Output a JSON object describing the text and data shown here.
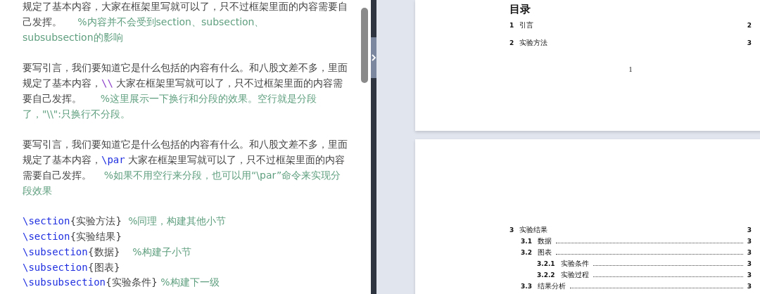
{
  "editor": {
    "paragraphs": [
      {
        "lines": [
          [
            {
              "kind": "text",
              "text": "规定了基本内容，大家在框架里写就可以了，只不过框架里面的内容需要自"
            }
          ],
          [
            {
              "kind": "text",
              "text": "己发挥。     "
            },
            {
              "kind": "comment",
              "text": "%内容并不会受到section、subsection、"
            }
          ],
          [
            {
              "kind": "comment",
              "text": "subsubsection的影响"
            }
          ]
        ]
      },
      {
        "lines": [
          [
            {
              "kind": "text",
              "text": "要写引言，我们要知道它是什么包括的内容有什么。和八股文差不多，里面"
            }
          ],
          [
            {
              "kind": "text",
              "text": "规定了基本内容，"
            },
            {
              "kind": "linebreak",
              "text": "\\\\"
            },
            {
              "kind": "text",
              "text": " 大家在框架里写就可以了，只不过框架里面的内容需"
            }
          ],
          [
            {
              "kind": "text",
              "text": "要自己发挥。      "
            },
            {
              "kind": "comment",
              "text": "%这里展示一下换行和分段的效果。空行就是分段"
            }
          ],
          [
            {
              "kind": "comment",
              "text": "了，\"\\\\\":只换行不分段。"
            }
          ]
        ]
      },
      {
        "lines": [
          [
            {
              "kind": "text",
              "text": "要写引言，我们要知道它是什么包括的内容有什么。和八股文差不多，里面"
            }
          ],
          [
            {
              "kind": "text",
              "text": "规定了基本内容，"
            },
            {
              "kind": "command",
              "text": "\\par"
            },
            {
              "kind": "text",
              "text": " 大家在框架里写就可以了，只不过框架里面的内容"
            }
          ],
          [
            {
              "kind": "text",
              "text": "需要自己发挥。    "
            },
            {
              "kind": "comment",
              "text": "%如果不用空行来分段，也可以用“\\par”命令来实现分"
            }
          ],
          [
            {
              "kind": "comment",
              "text": "段效果"
            }
          ]
        ]
      },
      {
        "lines": [
          [
            {
              "kind": "command",
              "text": "\\section"
            },
            {
              "kind": "text",
              "text": "{实验方法}  "
            },
            {
              "kind": "comment",
              "text": "%同理，构建其他小节"
            }
          ],
          [
            {
              "kind": "command",
              "text": "\\section"
            },
            {
              "kind": "text",
              "text": "{实验结果}"
            }
          ],
          [
            {
              "kind": "command",
              "text": "\\subsection"
            },
            {
              "kind": "text",
              "text": "{数据}    "
            },
            {
              "kind": "comment",
              "text": "%构建子小节"
            }
          ],
          [
            {
              "kind": "command",
              "text": "\\subsection"
            },
            {
              "kind": "text",
              "text": "{图表}"
            }
          ],
          [
            {
              "kind": "command",
              "text": "\\subsubsection"
            },
            {
              "kind": "text",
              "text": "{实验条件} "
            },
            {
              "kind": "comment",
              "text": "%构建下一级"
            }
          ]
        ]
      }
    ]
  },
  "preview": {
    "pages": [
      {
        "heading": "目录",
        "footer": "1",
        "toc": [
          {
            "number": "1",
            "title": "引言",
            "page": "2"
          },
          {
            "number": "2",
            "title": "实验方法",
            "page": "3"
          }
        ]
      },
      {
        "toc": [
          {
            "number": "3",
            "title": "实验结果",
            "page": "3",
            "children": [
              {
                "number": "3.1",
                "title": "数据",
                "page": "3"
              },
              {
                "number": "3.2",
                "title": "图表",
                "page": "3",
                "children": [
                  {
                    "number": "3.2.1",
                    "title": "实验条件",
                    "page": "3"
                  },
                  {
                    "number": "3.2.2",
                    "title": "实验过程",
                    "page": "3"
                  }
                ]
              },
              {
                "number": "3.3",
                "title": "结果分析",
                "page": "3"
              }
            ]
          }
        ]
      }
    ]
  }
}
